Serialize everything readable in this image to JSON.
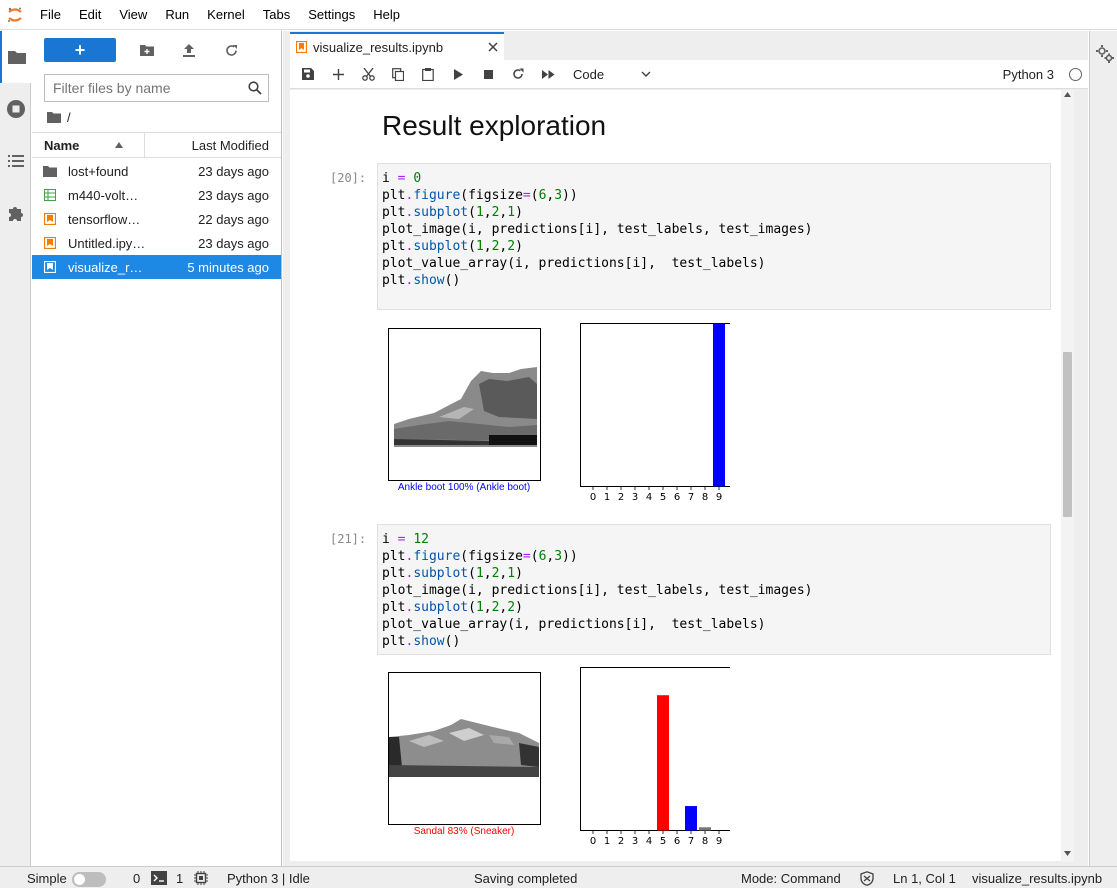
{
  "menu": [
    "File",
    "Edit",
    "View",
    "Run",
    "Kernel",
    "Tabs",
    "Settings",
    "Help"
  ],
  "filebrowser": {
    "filter_placeholder": "Filter files by name",
    "breadcrumb": "/",
    "col_name": "Name",
    "col_modified": "Last Modified",
    "files": [
      {
        "name": "lost+found",
        "modified": "23 days ago",
        "icon": "folder-icon"
      },
      {
        "name": "m440-volt…",
        "modified": "23 days ago",
        "icon": "spreadsheet-icon"
      },
      {
        "name": "tensorflow…",
        "modified": "22 days ago",
        "icon": "notebook-icon"
      },
      {
        "name": "Untitled.ipy…",
        "modified": "23 days ago",
        "icon": "notebook-icon"
      },
      {
        "name": "visualize_r…",
        "modified": "5 minutes ago",
        "icon": "notebook-icon"
      }
    ]
  },
  "tab": {
    "title": "visualize_results.ipynb"
  },
  "toolbar": {
    "cell_type": "Code",
    "kernel": "Python 3"
  },
  "notebook": {
    "heading": "Result exploration",
    "cells": [
      {
        "prompt": "[20]:",
        "caption": "Ankle boot 100% (Ankle boot)",
        "caption_color": "#0000ff"
      },
      {
        "prompt": "[21]:",
        "caption": "Sandal 83% (Sneaker)",
        "caption_color": "#ff0000"
      }
    ]
  },
  "chart_data": [
    {
      "type": "bar",
      "categories": [
        "0",
        "1",
        "2",
        "3",
        "4",
        "5",
        "6",
        "7",
        "8",
        "9"
      ],
      "values": [
        0,
        0,
        0,
        0,
        0,
        0,
        0,
        0,
        0,
        100
      ],
      "colors": [
        "#777777",
        "#777777",
        "#777777",
        "#777777",
        "#777777",
        "#777777",
        "#777777",
        "#777777",
        "#777777",
        "#0000ff"
      ],
      "ylim": [
        0,
        100
      ],
      "title": "",
      "xlabel": "",
      "ylabel": ""
    },
    {
      "type": "bar",
      "categories": [
        "0",
        "1",
        "2",
        "3",
        "4",
        "5",
        "6",
        "7",
        "8",
        "9"
      ],
      "values": [
        0,
        0,
        0,
        0,
        0,
        83,
        0,
        15,
        2,
        0
      ],
      "colors": [
        "#777777",
        "#777777",
        "#777777",
        "#777777",
        "#777777",
        "#ff0000",
        "#777777",
        "#0000ff",
        "#777777",
        "#777777"
      ],
      "ylim": [
        0,
        100
      ],
      "title": "",
      "xlabel": "",
      "ylabel": ""
    }
  ],
  "status": {
    "mode_label": "Simple",
    "terminals": "0",
    "kernels": "1",
    "kernel_state": "Python 3 | Idle",
    "message": "Saving completed",
    "command_mode": "Mode: Command",
    "cursor": "Ln 1, Col 1",
    "file": "visualize_results.ipynb"
  },
  "colors": {
    "accent": "#1976d2",
    "selected": "#1e88e5",
    "notebook_icon": "#f57c00"
  }
}
